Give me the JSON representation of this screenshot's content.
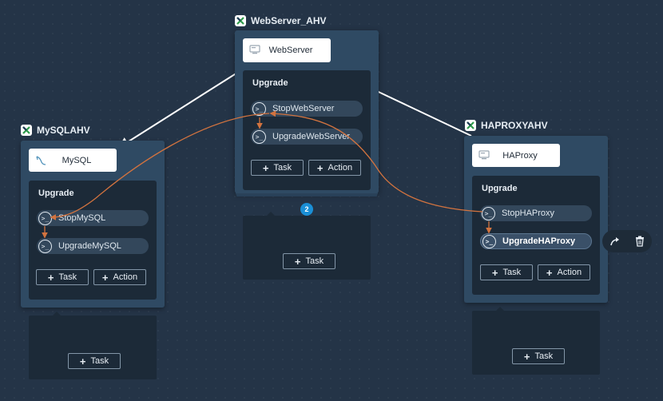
{
  "colors": {
    "canvas": "#243447",
    "service_card": "#2f4a63",
    "panel": "#1c2a38",
    "task_pill": "#33475b",
    "dependency_edge": "#ffffff",
    "task_edge": "#d2733f",
    "badge": "#1a8fd6"
  },
  "services": {
    "webserver": {
      "title": "WebServer_AHV",
      "substrate": "WebServer",
      "substrate_icon": "vm-icon",
      "action_title": "Upgrade",
      "tasks": [
        "StopWebServer",
        "UpgradeWebServer"
      ],
      "add_task": "Task",
      "add_action": "Action",
      "replica_count": "2",
      "lower_add_task": "Task"
    },
    "mysql": {
      "title": "MySQLAHV",
      "substrate": "MySQL",
      "substrate_icon": "mysql-dolphin-icon",
      "action_title": "Upgrade",
      "tasks": [
        "StopMySQL",
        "UpgradeMySQL"
      ],
      "add_task": "Task",
      "add_action": "Action",
      "lower_add_task": "Task"
    },
    "haproxy": {
      "title": "HAPROXYAHV",
      "substrate": "HAProxy",
      "substrate_icon": "vm-icon",
      "action_title": "Upgrade",
      "tasks": [
        "StopHAProxy",
        "UpgradeHAProxy"
      ],
      "selected_task": "UpgradeHAProxy",
      "add_task": "Task",
      "add_action": "Action",
      "lower_add_task": "Task"
    }
  },
  "task_toolbar": {
    "tools": [
      "connect-arrow-icon",
      "trash-icon"
    ]
  }
}
